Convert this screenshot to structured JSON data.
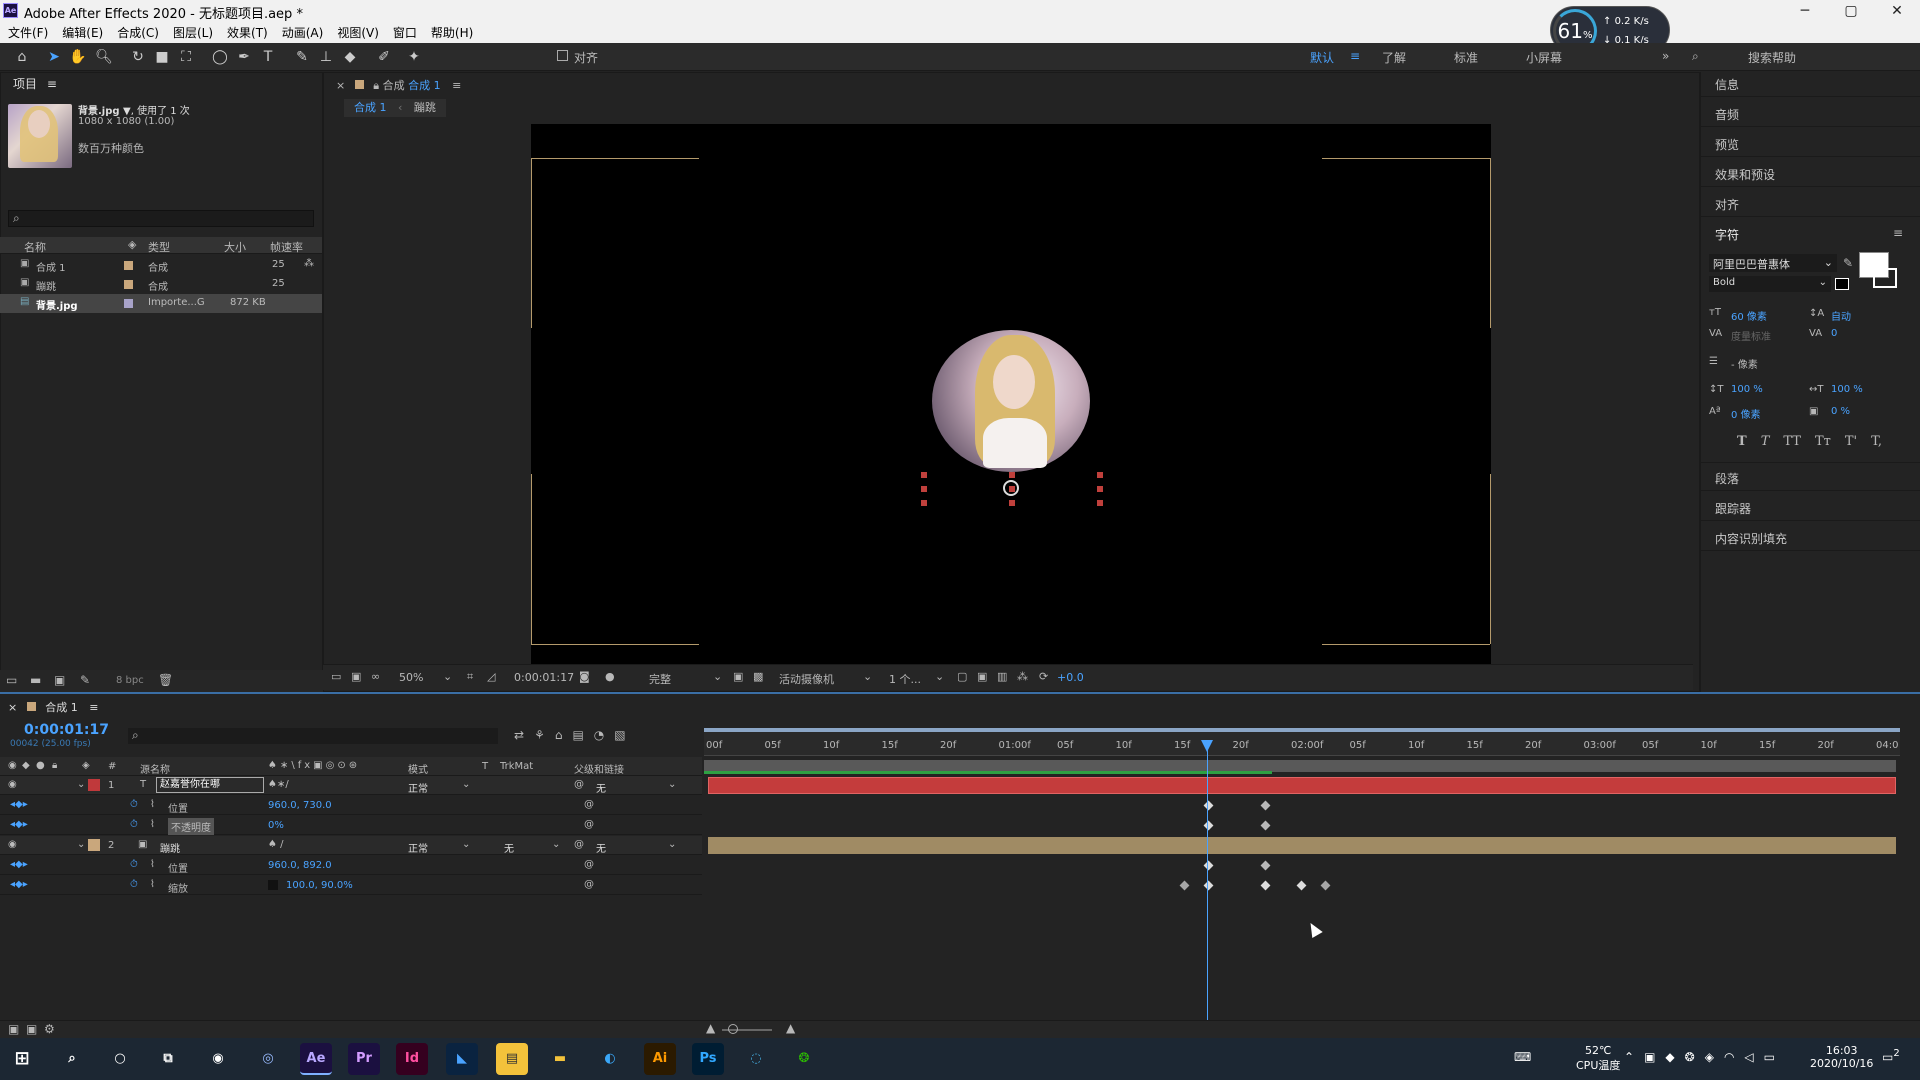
{
  "window": {
    "title": "Adobe After Effects 2020 - 无标题项目.aep *",
    "minimize": "─",
    "maximize": "▢",
    "close": "✕"
  },
  "menu": [
    "文件(F)",
    "编辑(E)",
    "合成(C)",
    "图层(L)",
    "效果(T)",
    "动画(A)",
    "视图(V)",
    "窗口",
    "帮助(H)"
  ],
  "net": {
    "percent": "61",
    "pct_sign": "%",
    "up": "0.2",
    "down": "0.1",
    "unit": "K/s"
  },
  "toolbar": {
    "align": "对齐",
    "workspaces": [
      "默认",
      "了解",
      "标准",
      "小屏幕"
    ],
    "search": "搜索帮助"
  },
  "project": {
    "title": "项目",
    "asset_name": "背景.jpg ▼",
    "asset_used": ", 使用了 1 次",
    "asset_dims": "1080 x 1080 (1.00)",
    "asset_colors": "数百万种颜色",
    "cols": [
      "名称",
      "类型",
      "大小",
      "帧速率"
    ],
    "rows": [
      {
        "name": "合成 1",
        "type": "合成",
        "size": "",
        "fps": "25"
      },
      {
        "name": "蹦跳",
        "type": "合成",
        "size": "",
        "fps": "25"
      },
      {
        "name": "背景.jpg",
        "type": "Importe...G",
        "size": "872 KB",
        "fps": ""
      }
    ],
    "bpc": "8 bpc"
  },
  "comp": {
    "tab_label": "合成",
    "tab_name": "合成 1",
    "crumb1": "合成 1",
    "crumb2": "蹦跳"
  },
  "viewer_bar": {
    "zoom": "50%",
    "time": "0:00:01:17",
    "quality": "完整",
    "camera": "活动摄像机",
    "views": "1 个...",
    "exposure": "+0.0"
  },
  "right": {
    "items": [
      "信息",
      "音频",
      "预览",
      "效果和预设",
      "对齐"
    ],
    "char_title": "字符",
    "font": "阿里巴巴普惠体",
    "style": "Bold",
    "size": "60 像素",
    "leading": "自动",
    "kerning": "度量标准",
    "tracking": "0",
    "stroke": "- 像素",
    "vscale": "100 %",
    "hscale": "100 %",
    "baseline": "0 像素",
    "tsume": "0 %",
    "type_styles": [
      "T",
      "T",
      "TT",
      "Tт",
      "T'",
      "T,"
    ],
    "items2": [
      "段落",
      "跟踪器",
      "内容识别填充"
    ]
  },
  "timeline": {
    "tab": "合成 1",
    "time": "0:00:01:17",
    "frames": "00042 (25.00 fps)",
    "cols": [
      "#",
      "源名称",
      "模式",
      "T",
      "TrkMat",
      "父级和链接"
    ],
    "layers": [
      {
        "num": "1",
        "name": "赵嘉誉你在哪",
        "mode": "正常",
        "trk": "",
        "parent": "无",
        "prop1": "位置",
        "val1": "960.0, 730.0",
        "prop2": "不透明度",
        "val2": "0%"
      },
      {
        "num": "2",
        "name": "蹦跳",
        "mode": "正常",
        "trk": "无",
        "parent": "无",
        "prop1": "位置",
        "val1": "960.0, 892.0",
        "prop2": "缩放",
        "val2": "100.0, 90.0%"
      }
    ],
    "ruler": [
      "00f",
      "05f",
      "10f",
      "15f",
      "20f",
      "01:00f",
      "05f",
      "10f",
      "15f",
      "20f",
      "02:00f",
      "05f",
      "10f",
      "15f",
      "20f",
      "03:00f",
      "05f",
      "10f",
      "15f",
      "20f",
      "04:0"
    ]
  },
  "taskbar": {
    "temp": "52℃",
    "temp_label": "CPU温度",
    "time": "16:03",
    "date": "2020/10/16",
    "notif": "2",
    "apps": [
      "Ae",
      "Pr",
      "Id",
      "Ps",
      "Ai"
    ]
  }
}
